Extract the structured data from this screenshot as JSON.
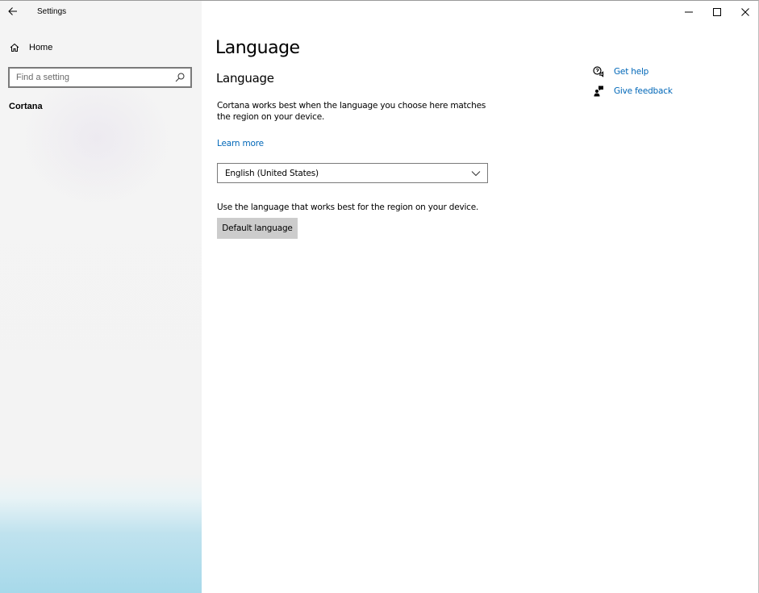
{
  "window": {
    "title": "Settings",
    "controls": {
      "minimize_icon": "minimize-icon",
      "maximize_icon": "maximize-icon",
      "close_icon": "close-icon"
    }
  },
  "sidebar": {
    "back_icon": "back-arrow-icon",
    "home_label": "Home",
    "search_placeholder": "Find a setting",
    "section_label": "Cortana"
  },
  "main": {
    "page_title": "Language",
    "section_title": "Language",
    "description": "Cortana works best when the language you choose here matches the region on your device.",
    "learn_more": "Learn more",
    "language_select": {
      "selected": "English (United States)"
    },
    "default_desc": "Use the language that works best for the region on your device.",
    "default_button": "Default language"
  },
  "help": {
    "get_help": "Get help",
    "give_feedback": "Give feedback"
  },
  "colors": {
    "accent": "#0067b8",
    "button_bg": "#cccccc",
    "sidebar_bg": "#f3f3f3"
  }
}
